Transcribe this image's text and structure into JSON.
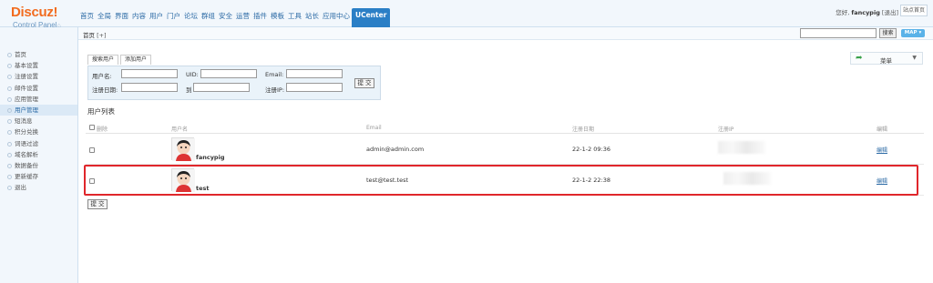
{
  "header": {
    "logo_text": "Discuz!",
    "logo_sub": "Control Panel",
    "nav": [
      "首页",
      "全局",
      "界面",
      "内容",
      "用户",
      "门户",
      "论坛",
      "群组",
      "安全",
      "运营",
      "插件",
      "模板",
      "工具",
      "站长",
      "应用中心",
      "UCenter"
    ],
    "active_nav": "UCenter",
    "greeting": "您好,",
    "username": "fancypig",
    "logout": "[退出]",
    "site_home": "站点首页"
  },
  "subbar": {
    "breadcrumb": "首页",
    "add": "[+]",
    "search_button": "搜索",
    "map_button": "MAP"
  },
  "sidebar": {
    "items": [
      "首页",
      "基本设置",
      "注册设置",
      "邮件设置",
      "应用管理",
      "用户管理",
      "短消息",
      "积分兑换",
      "词语过滤",
      "域名解析",
      "数据备份",
      "更新缓存",
      "退出"
    ],
    "active": "用户管理"
  },
  "menu": {
    "label": "菜单"
  },
  "search_form": {
    "tabs": [
      "搜索用户",
      "添加用户"
    ],
    "username_label": "用户名:",
    "uid_label": "UID:",
    "email_label": "Email:",
    "regdate_label": "注册日期:",
    "to_label": "到",
    "regip_label": "注册IP:",
    "submit": "提 交"
  },
  "list": {
    "title": "用户列表",
    "columns": {
      "delete": "删除",
      "username": "用户名",
      "email": "Email",
      "regdate": "注册日期",
      "regip": "注册IP",
      "edit": "编辑"
    },
    "rows": [
      {
        "username": "fancypig",
        "email": "admin@admin.com",
        "date": "22-1-2 09:36",
        "edit": "编辑"
      },
      {
        "username": "test",
        "email": "test@test.test",
        "date": "22-1-2 22:38",
        "edit": "编辑"
      }
    ],
    "submit": "提 交"
  },
  "colors": {
    "logo": "#f26c1f",
    "nav_active": "#2b7fc6",
    "highlight": "#e0262b"
  }
}
